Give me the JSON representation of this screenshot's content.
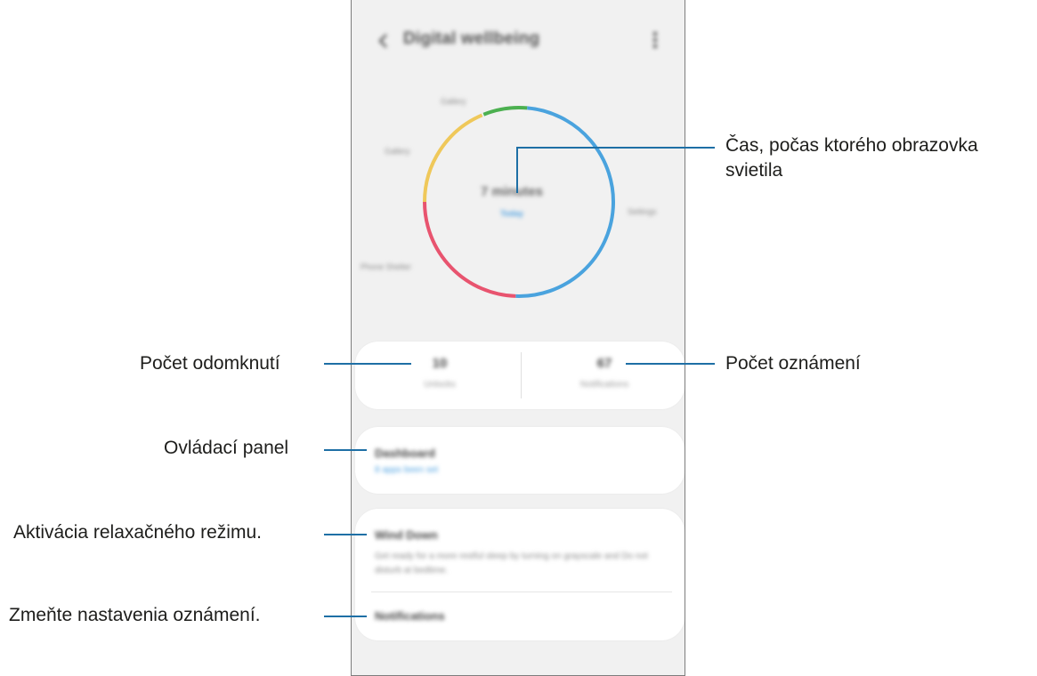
{
  "app": {
    "title": "Digital wellbeing",
    "back_icon": "back-arrow-icon",
    "more_icon": "more-vert-icon"
  },
  "chart": {
    "total": "7 minutes",
    "link": "Today",
    "segments": [
      {
        "name": "green",
        "color": "#4cb050",
        "start_deg": -22,
        "end_deg": 5
      },
      {
        "name": "blue",
        "color": "#4aa3de",
        "start_deg": 5,
        "end_deg": 182
      },
      {
        "name": "red",
        "color": "#e8546f",
        "start_deg": 182,
        "end_deg": 270
      },
      {
        "name": "yellow",
        "color": "#efc85a",
        "start_deg": 270,
        "end_deg": 337
      }
    ],
    "labels": [
      "Gallery",
      "Gallery",
      "Settings",
      "Phone Shelter"
    ]
  },
  "stats": {
    "unlocks_value": "10",
    "unlocks_label": "Unlocks",
    "notifications_value": "67",
    "notifications_label": "Notifications"
  },
  "dashboard": {
    "title": "Dashboard",
    "subtitle": "8 apps been set"
  },
  "wind_down": {
    "title": "Wind Down",
    "description": "Get ready for a more restful sleep by turning on grayscale and Do not disturb at bedtime."
  },
  "notifications": {
    "title": "Notifications"
  },
  "callouts": {
    "screen_time": "Čas, počas ktorého obrazovka\nsvietila",
    "unlocks": "Počet odomknutí",
    "notifications_count": "Počet oznámení",
    "dashboard": "Ovládací panel",
    "wind_down": "Aktivácia relaxačného režimu.",
    "notification_settings": "Zmeňte nastavenia oznámení."
  }
}
